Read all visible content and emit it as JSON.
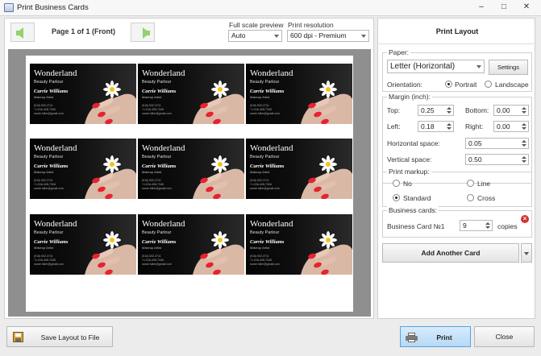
{
  "window": {
    "title": "Print Business Cards",
    "minimize_glyph": "–",
    "maximize_glyph": "□",
    "close_glyph": "✕"
  },
  "toolbar": {
    "page_label": "Page 1 of 1 (Front)",
    "full_scale_label": "Full scale preview",
    "full_scale_value": "Auto",
    "resolution_label": "Print resolution",
    "resolution_value": "600 dpi - Premium"
  },
  "card": {
    "title": "Wonderland",
    "subtitle": "Beauty Parlour",
    "name": "Carrie Williams",
    "role": "Makeup Artist",
    "line1": "(516) 832-3711",
    "line2": "+1-516-408-7346",
    "line3": "sarah.fuller@gmail.com"
  },
  "layout": {
    "title": "Print Layout",
    "paper_label": "Paper:",
    "paper_value": "Letter (Horizontal)",
    "settings_label": "Settings",
    "orientation_label": "Orientation:",
    "portrait_label": "Portrait",
    "landscape_label": "Landscape",
    "margin_label": "Margin (inch):",
    "top_label": "Top:",
    "top_value": "0.25",
    "bottom_label": "Bottom:",
    "bottom_value": "0.00",
    "left_label": "Left:",
    "left_value": "0.18",
    "right_label": "Right:",
    "right_value": "0.00",
    "hspace_label": "Horizontal space:",
    "hspace_value": "0.05",
    "vspace_label": "Vertical space:",
    "vspace_value": "0.50",
    "markup_label": "Print markup:",
    "markup_no": "No",
    "markup_line": "Line",
    "markup_standard": "Standard",
    "markup_cross": "Cross",
    "bcards_label": "Business cards:",
    "bcard_name": "Business Card №1",
    "bcard_copies": "9",
    "copies_label": "copies",
    "add_another_label": "Add Another Card"
  },
  "footer": {
    "save_label": "Save Layout to File",
    "print_label": "Print",
    "close_label": "Close"
  },
  "colors": {
    "accent": "#b6d9f6",
    "nav_arrow": "#8fd36a",
    "delete": "#d8302f"
  }
}
